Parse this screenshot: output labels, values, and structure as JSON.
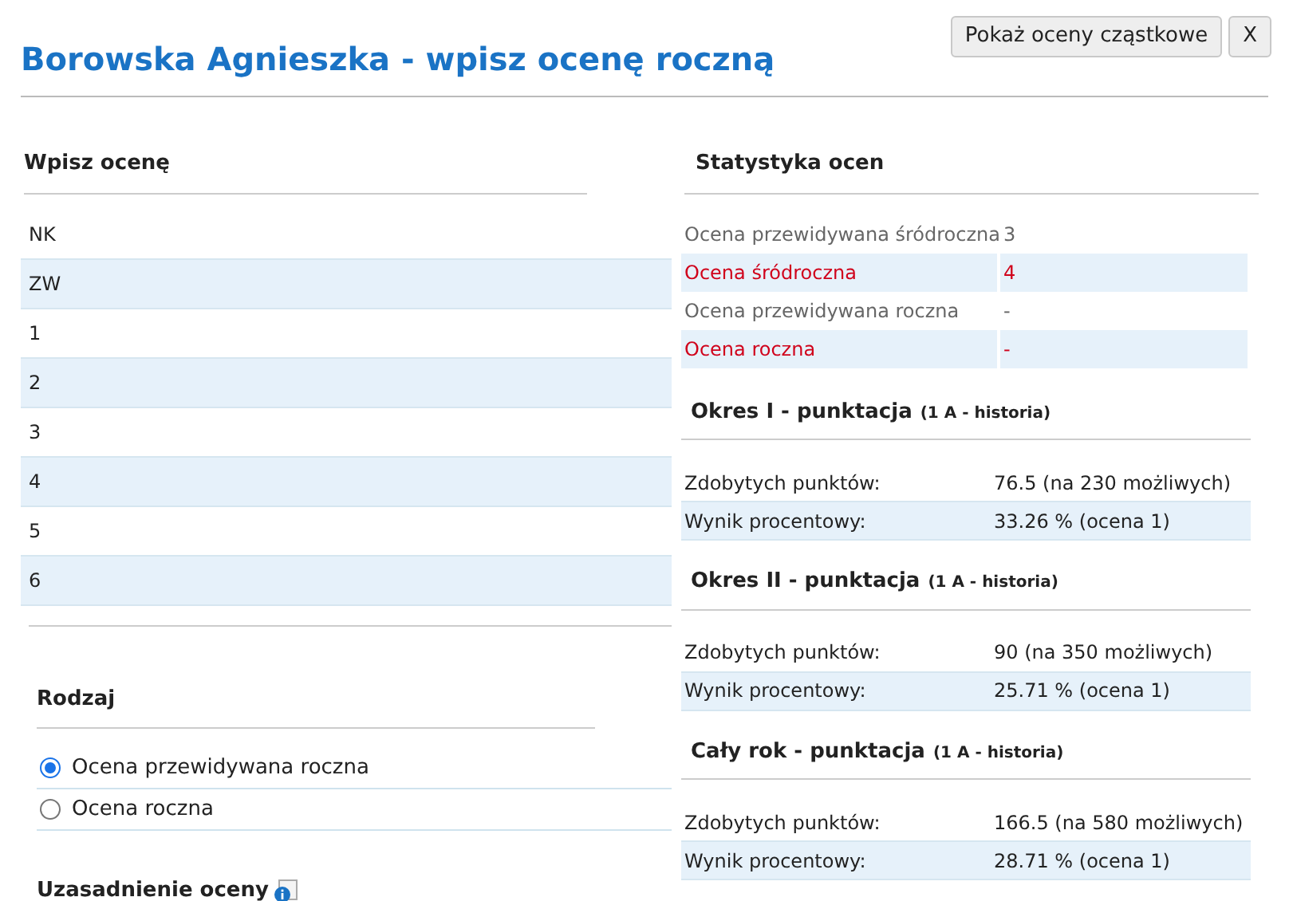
{
  "title": "Borowska Agnieszka - wpisz ocenę roczną",
  "buttons": [
    "Pokaż oceny cząstkowe",
    "X"
  ],
  "grade_entry": {
    "heading": "Wpisz ocenę",
    "grades": [
      "NK",
      "ZW",
      "1",
      "2",
      "3",
      "4",
      "5",
      "6"
    ]
  },
  "kind_section": {
    "heading": "Rodzaj",
    "options": [
      {
        "label": "Ocena przewidywana roczna",
        "selected": true
      },
      {
        "label": "Ocena roczna",
        "selected": false
      }
    ]
  },
  "justification": {
    "heading": "Uzasadnienie oceny"
  },
  "statistics": {
    "heading": "Statystyka ocen",
    "rows": [
      {
        "kind": "predicted",
        "label": "Ocena przewidywana śródroczna",
        "value": "3"
      },
      {
        "kind": "final",
        "label": "Ocena śródroczna",
        "value": "4"
      },
      {
        "kind": "predicted",
        "label": "Ocena przewidywana roczna",
        "value": "-"
      },
      {
        "kind": "final",
        "label": "Ocena roczna",
        "value": "-"
      }
    ]
  },
  "periods": [
    {
      "title": "Okres I - punktacja",
      "subtitle": "(1 A - historia)",
      "rows": [
        {
          "label": "Zdobytych punktów:",
          "value": "76.5 (na 230 możliwych)"
        },
        {
          "label": "Wynik procentowy:",
          "value": "33.26 % (ocena 1)"
        }
      ]
    },
    {
      "title": "Okres II - punktacja",
      "subtitle": "(1 A - historia)",
      "rows": [
        {
          "label": "Zdobytych punktów:",
          "value": "90 (na 350 możliwych)"
        },
        {
          "label": "Wynik procentowy:",
          "value": "25.71 % (ocena 1)"
        }
      ]
    },
    {
      "title": "Cały rok - punktacja",
      "subtitle": "(1 A - historia)",
      "rows": [
        {
          "label": "Zdobytych punktów:",
          "value": "166.5 (na 580 możliwych)"
        },
        {
          "label": "Wynik procentowy:",
          "value": "28.71 % (ocena 1)"
        }
      ]
    }
  ]
}
